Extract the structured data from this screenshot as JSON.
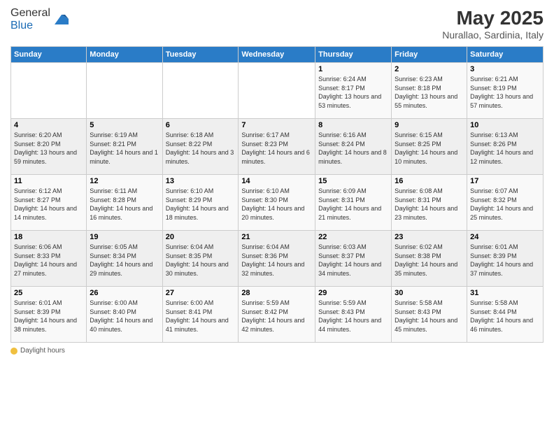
{
  "header": {
    "logo_general": "General",
    "logo_blue": "Blue",
    "title": "May 2025",
    "location": "Nurallao, Sardinia, Italy"
  },
  "days_of_week": [
    "Sunday",
    "Monday",
    "Tuesday",
    "Wednesday",
    "Thursday",
    "Friday",
    "Saturday"
  ],
  "weeks": [
    [
      {
        "day": "",
        "info": ""
      },
      {
        "day": "",
        "info": ""
      },
      {
        "day": "",
        "info": ""
      },
      {
        "day": "",
        "info": ""
      },
      {
        "day": "1",
        "info": "Sunrise: 6:24 AM\nSunset: 8:17 PM\nDaylight: 13 hours\nand 53 minutes."
      },
      {
        "day": "2",
        "info": "Sunrise: 6:23 AM\nSunset: 8:18 PM\nDaylight: 13 hours\nand 55 minutes."
      },
      {
        "day": "3",
        "info": "Sunrise: 6:21 AM\nSunset: 8:19 PM\nDaylight: 13 hours\nand 57 minutes."
      }
    ],
    [
      {
        "day": "4",
        "info": "Sunrise: 6:20 AM\nSunset: 8:20 PM\nDaylight: 13 hours\nand 59 minutes."
      },
      {
        "day": "5",
        "info": "Sunrise: 6:19 AM\nSunset: 8:21 PM\nDaylight: 14 hours\nand 1 minute."
      },
      {
        "day": "6",
        "info": "Sunrise: 6:18 AM\nSunset: 8:22 PM\nDaylight: 14 hours\nand 3 minutes."
      },
      {
        "day": "7",
        "info": "Sunrise: 6:17 AM\nSunset: 8:23 PM\nDaylight: 14 hours\nand 6 minutes."
      },
      {
        "day": "8",
        "info": "Sunrise: 6:16 AM\nSunset: 8:24 PM\nDaylight: 14 hours\nand 8 minutes."
      },
      {
        "day": "9",
        "info": "Sunrise: 6:15 AM\nSunset: 8:25 PM\nDaylight: 14 hours\nand 10 minutes."
      },
      {
        "day": "10",
        "info": "Sunrise: 6:13 AM\nSunset: 8:26 PM\nDaylight: 14 hours\nand 12 minutes."
      }
    ],
    [
      {
        "day": "11",
        "info": "Sunrise: 6:12 AM\nSunset: 8:27 PM\nDaylight: 14 hours\nand 14 minutes."
      },
      {
        "day": "12",
        "info": "Sunrise: 6:11 AM\nSunset: 8:28 PM\nDaylight: 14 hours\nand 16 minutes."
      },
      {
        "day": "13",
        "info": "Sunrise: 6:10 AM\nSunset: 8:29 PM\nDaylight: 14 hours\nand 18 minutes."
      },
      {
        "day": "14",
        "info": "Sunrise: 6:10 AM\nSunset: 8:30 PM\nDaylight: 14 hours\nand 20 minutes."
      },
      {
        "day": "15",
        "info": "Sunrise: 6:09 AM\nSunset: 8:31 PM\nDaylight: 14 hours\nand 21 minutes."
      },
      {
        "day": "16",
        "info": "Sunrise: 6:08 AM\nSunset: 8:31 PM\nDaylight: 14 hours\nand 23 minutes."
      },
      {
        "day": "17",
        "info": "Sunrise: 6:07 AM\nSunset: 8:32 PM\nDaylight: 14 hours\nand 25 minutes."
      }
    ],
    [
      {
        "day": "18",
        "info": "Sunrise: 6:06 AM\nSunset: 8:33 PM\nDaylight: 14 hours\nand 27 minutes."
      },
      {
        "day": "19",
        "info": "Sunrise: 6:05 AM\nSunset: 8:34 PM\nDaylight: 14 hours\nand 29 minutes."
      },
      {
        "day": "20",
        "info": "Sunrise: 6:04 AM\nSunset: 8:35 PM\nDaylight: 14 hours\nand 30 minutes."
      },
      {
        "day": "21",
        "info": "Sunrise: 6:04 AM\nSunset: 8:36 PM\nDaylight: 14 hours\nand 32 minutes."
      },
      {
        "day": "22",
        "info": "Sunrise: 6:03 AM\nSunset: 8:37 PM\nDaylight: 14 hours\nand 34 minutes."
      },
      {
        "day": "23",
        "info": "Sunrise: 6:02 AM\nSunset: 8:38 PM\nDaylight: 14 hours\nand 35 minutes."
      },
      {
        "day": "24",
        "info": "Sunrise: 6:01 AM\nSunset: 8:39 PM\nDaylight: 14 hours\nand 37 minutes."
      }
    ],
    [
      {
        "day": "25",
        "info": "Sunrise: 6:01 AM\nSunset: 8:39 PM\nDaylight: 14 hours\nand 38 minutes."
      },
      {
        "day": "26",
        "info": "Sunrise: 6:00 AM\nSunset: 8:40 PM\nDaylight: 14 hours\nand 40 minutes."
      },
      {
        "day": "27",
        "info": "Sunrise: 6:00 AM\nSunset: 8:41 PM\nDaylight: 14 hours\nand 41 minutes."
      },
      {
        "day": "28",
        "info": "Sunrise: 5:59 AM\nSunset: 8:42 PM\nDaylight: 14 hours\nand 42 minutes."
      },
      {
        "day": "29",
        "info": "Sunrise: 5:59 AM\nSunset: 8:43 PM\nDaylight: 14 hours\nand 44 minutes."
      },
      {
        "day": "30",
        "info": "Sunrise: 5:58 AM\nSunset: 8:43 PM\nDaylight: 14 hours\nand 45 minutes."
      },
      {
        "day": "31",
        "info": "Sunrise: 5:58 AM\nSunset: 8:44 PM\nDaylight: 14 hours\nand 46 minutes."
      }
    ]
  ],
  "footer": {
    "daylight_hours_label": "Daylight hours"
  }
}
